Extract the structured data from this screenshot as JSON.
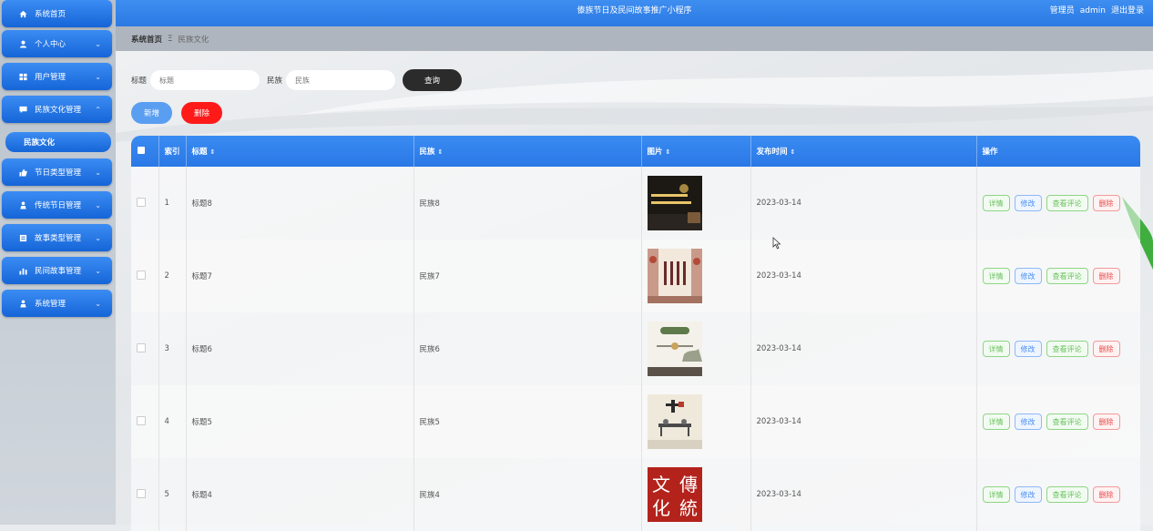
{
  "app": {
    "title": "傣族节日及民间故事推广小程序",
    "user_role": "管理员",
    "user_name": "admin",
    "logout": "退出登录"
  },
  "sidebar": {
    "items": [
      {
        "icon": "home-icon",
        "label": "系统首页"
      },
      {
        "icon": "user-icon",
        "label": "个人中心"
      },
      {
        "icon": "grid-icon",
        "label": "用户管理"
      },
      {
        "icon": "chat-icon",
        "label": "民族文化管理"
      },
      {
        "icon": "thumb-icon",
        "label": "节日类型管理"
      },
      {
        "icon": "person-icon",
        "label": "传统节日管理"
      },
      {
        "icon": "doc-icon",
        "label": "故事类型管理"
      },
      {
        "icon": "bar-chart-icon",
        "label": "民间故事管理"
      },
      {
        "icon": "person-icon",
        "label": "系统管理"
      }
    ],
    "active_sub": "民族文化"
  },
  "breadcrumb": {
    "home": "系统首页",
    "separator": "Ξ",
    "current": "民族文化"
  },
  "search": {
    "title_label": "标题",
    "title_placeholder": "标题",
    "nation_label": "民族",
    "nation_placeholder": "民族",
    "query_button": "查询"
  },
  "actions": {
    "add": "新增",
    "delete": "删除"
  },
  "table": {
    "headers": {
      "index": "索引",
      "title": "标题",
      "nation": "民族",
      "image": "图片",
      "published": "发布时间",
      "ops": "操作"
    },
    "row_actions": {
      "detail": "详情",
      "edit": "修改",
      "comments": "查看评论",
      "delete": "删除"
    },
    "rows": [
      {
        "index": "1",
        "title": "标题8",
        "nation": "民族8",
        "date": "2023-03-14"
      },
      {
        "index": "2",
        "title": "标题7",
        "nation": "民族7",
        "date": "2023-03-14"
      },
      {
        "index": "3",
        "title": "标题6",
        "nation": "民族6",
        "date": "2023-03-14"
      },
      {
        "index": "4",
        "title": "标题5",
        "nation": "民族5",
        "date": "2023-03-14"
      },
      {
        "index": "5",
        "title": "标题4",
        "nation": "民族4",
        "date": "2023-03-14"
      }
    ],
    "thumb5_text": [
      "文",
      "傳",
      "化",
      "統"
    ]
  },
  "colors": {
    "primary": "#2b79e4",
    "danger": "#ff1a1a",
    "dark": "#2b2b2b"
  }
}
